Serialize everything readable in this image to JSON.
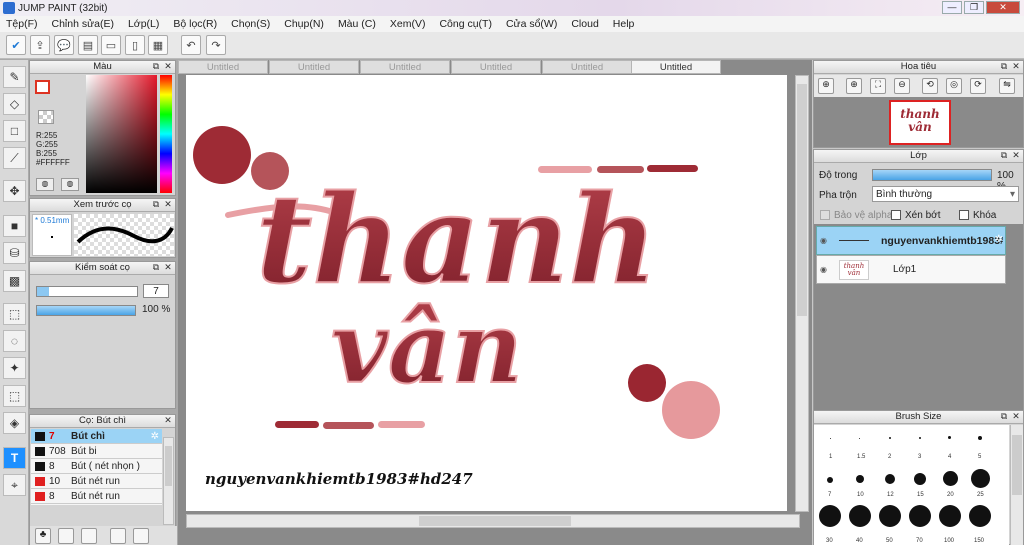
{
  "window": {
    "title": "JUMP PAINT (32bit)"
  },
  "menu": [
    "Tệp(F)",
    "Chỉnh sửa(E)",
    "Lớp(L)",
    "Bộ lọc(R)",
    "Chọn(S)",
    "Chụp(N)",
    "Màu (C)",
    "Xem(V)",
    "Công cụ(T)",
    "Cửa sổ(W)",
    "Cloud",
    "Help"
  ],
  "color_panel": {
    "title": "Màu",
    "r": "R:255",
    "g": "G:255",
    "b": "B:255",
    "hex": "#FFFFFF"
  },
  "brush_preview": {
    "title": "Xem trước cọ",
    "size": "0.51mm"
  },
  "brush_control": {
    "title": "Kiểm soát cọ",
    "size_value": "7",
    "opacity": "100 %"
  },
  "brush_list": {
    "title": "Cọ: Bút chì",
    "items": [
      {
        "num": "7",
        "name": "Bút chì",
        "color": "#111111"
      },
      {
        "num": "708",
        "name": "Bút bi",
        "color": "#111111"
      },
      {
        "num": "8",
        "name": "Bút ( nét nhọn )",
        "color": "#111111"
      },
      {
        "num": "10",
        "name": "Bút nét run",
        "color": "#e02020"
      },
      {
        "num": "8",
        "name": "Bút nét run",
        "color": "#e02020"
      }
    ]
  },
  "tabs": [
    "Untitled",
    "Untitled",
    "Untitled",
    "Untitled",
    "Untitled",
    "Untitled"
  ],
  "canvas": {
    "line1": "thanh",
    "line2": "vân",
    "signature": "nguyenvankhiemtb1983#hd247"
  },
  "navigator": {
    "title": "Hoa tiêu",
    "thumb_line1": "thanh",
    "thumb_line2": "vân"
  },
  "layers": {
    "title": "Lớp",
    "opacity_label": "Độ trong",
    "opacity_value": "100 %",
    "blend_label": "Pha trộn",
    "blend_value": "Bình thường",
    "protect_alpha": "Bảo vệ alpha",
    "clip": "Xén bớt",
    "lock": "Khóa",
    "items": [
      {
        "name": "nguyenvankhiemtb1983#"
      },
      {
        "name": "Lớp1"
      }
    ]
  },
  "brush_size": {
    "title": "Brush Size",
    "labels_row1": [
      "1",
      "1.5",
      "2",
      "3",
      "4",
      "5"
    ],
    "labels_row2": [
      "7",
      "10",
      "12",
      "15",
      "20",
      "25"
    ],
    "labels_row3": [
      "30",
      "40",
      "50",
      "70",
      "100",
      "150"
    ]
  },
  "colors": {
    "accent": "#1e90ff",
    "ink": "#9e2b35",
    "pink": "#e8a0a4"
  }
}
